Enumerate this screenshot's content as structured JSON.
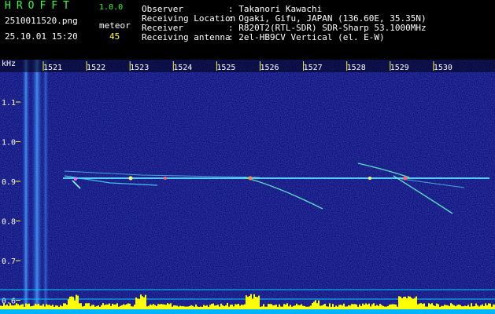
{
  "header": {
    "app_title": "HROFFT",
    "app_version": "1.0.0",
    "filename": "2510011520.png",
    "datetime": "25.10.01 15:20",
    "meteor_label": "meteor",
    "meteor_count": "45",
    "info": [
      {
        "label": "Observer",
        "value": ": Takanori Kawachi"
      },
      {
        "label": "Receiving Location",
        "value": ": Ogaki, Gifu, JAPAN (136.60E, 35.35N)"
      },
      {
        "label": "Receiver",
        "value": ": R820T2(RTL-SDR) SDR-Sharp 53.1000MHz"
      },
      {
        "label": "Receiving antenna",
        "value": ": 2el-HB9CV Vertical (el. E-W)"
      }
    ]
  },
  "spectrogram": {
    "y_unit": "kHz",
    "x_ticks": [
      "1521",
      "1522",
      "1523",
      "1524",
      "1525",
      "1526",
      "1527",
      "1528",
      "1529",
      "1530"
    ],
    "y_ticks": [
      "1.1",
      "1.0",
      "0.9",
      "0.8",
      "0.7",
      "0.6"
    ],
    "colors": {
      "background": "#0a0a78",
      "signal": "#33ccff",
      "tick": "#ffff33",
      "power": "#ffff00",
      "baseline": "#00ccff"
    }
  }
}
